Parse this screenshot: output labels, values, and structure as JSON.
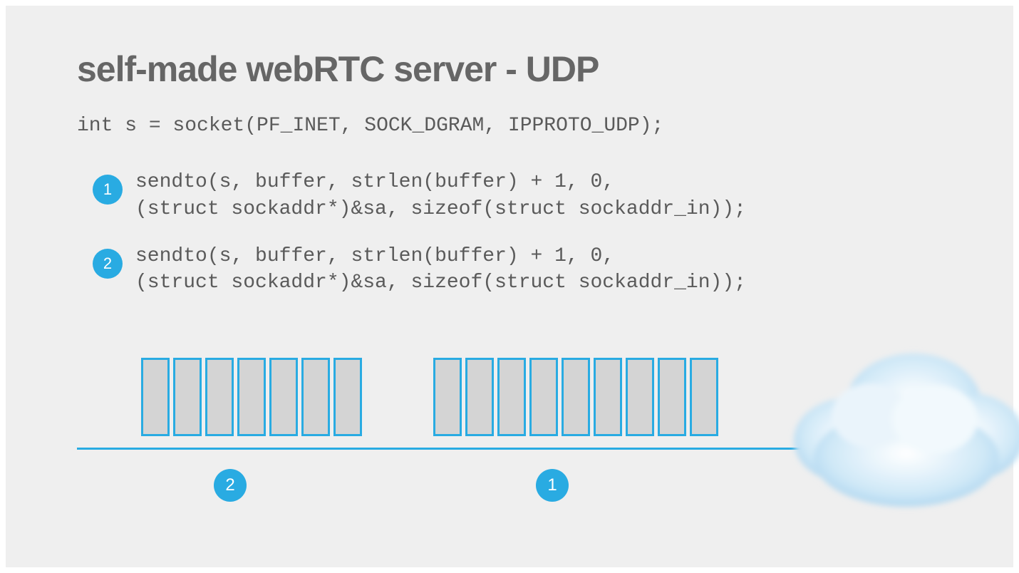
{
  "title": "self-made webRTC server - UDP",
  "socket_line": "int s = socket(PF_INET, SOCK_DGRAM, IPPROTO_UDP);",
  "bullets": [
    {
      "num": "1",
      "code": "sendto(s, buffer, strlen(buffer) + 1, 0,\n(struct sockaddr*)&sa, sizeof(struct sockaddr_in));"
    },
    {
      "num": "2",
      "code": "sendto(s, buffer, strlen(buffer) + 1, 0,\n(struct sockaddr*)&sa, sizeof(struct sockaddr_in));"
    }
  ],
  "diagram": {
    "group1_packets": 7,
    "group2_packets": 9,
    "badge_left": "2",
    "badge_right": "1"
  },
  "chart_data": {
    "type": "diagram",
    "description": "UDP packet transmission timeline showing two sendto() calls producing packet groups traveling toward destination (cloud)",
    "arrow_direction": "left-to-right",
    "groups": [
      {
        "label": "2",
        "packet_count": 7,
        "position": "left"
      },
      {
        "label": "1",
        "packet_count": 9,
        "position": "right"
      }
    ],
    "destination": "cloud"
  }
}
